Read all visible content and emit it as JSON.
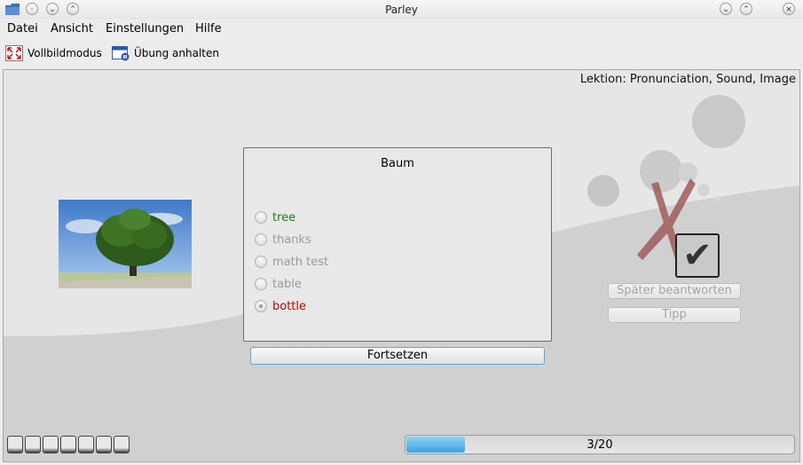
{
  "window": {
    "title": "Parley"
  },
  "menubar": {
    "items": [
      "Datei",
      "Ansicht",
      "Einstellungen",
      "Hilfe"
    ]
  },
  "toolbar": {
    "fullscreen_label": "Vollbildmodus",
    "pause_label": "Übung anhalten"
  },
  "practice": {
    "lesson_label": "Lektion: Pronunciation, Sound, Image",
    "question": "Baum",
    "options": [
      {
        "label": "tree",
        "state": "correct"
      },
      {
        "label": "thanks",
        "state": "neutral"
      },
      {
        "label": "math test",
        "state": "neutral"
      },
      {
        "label": "table",
        "state": "neutral"
      },
      {
        "label": "bottle",
        "state": "wrong-selected"
      }
    ],
    "continue_label": "Fortsetzen",
    "later_label": "Später beantworten",
    "hint_label": "Tipp"
  },
  "status": {
    "progress_text": "3/20",
    "progress_fraction": 0.15,
    "answer_blocks": 7
  },
  "colors": {
    "correct": "#1e7a1e",
    "wrong": "#c00000",
    "muted": "#9a9a9a",
    "progress": "#3aa3e0"
  },
  "icons": [
    "folder-icon",
    "help-icon",
    "minimize-icon",
    "maximize-icon",
    "shade-icon",
    "keep-above-icon",
    "close-icon",
    "fullscreen-icon",
    "pause-icon",
    "wrong-cross-icon",
    "correct-check-icon"
  ]
}
